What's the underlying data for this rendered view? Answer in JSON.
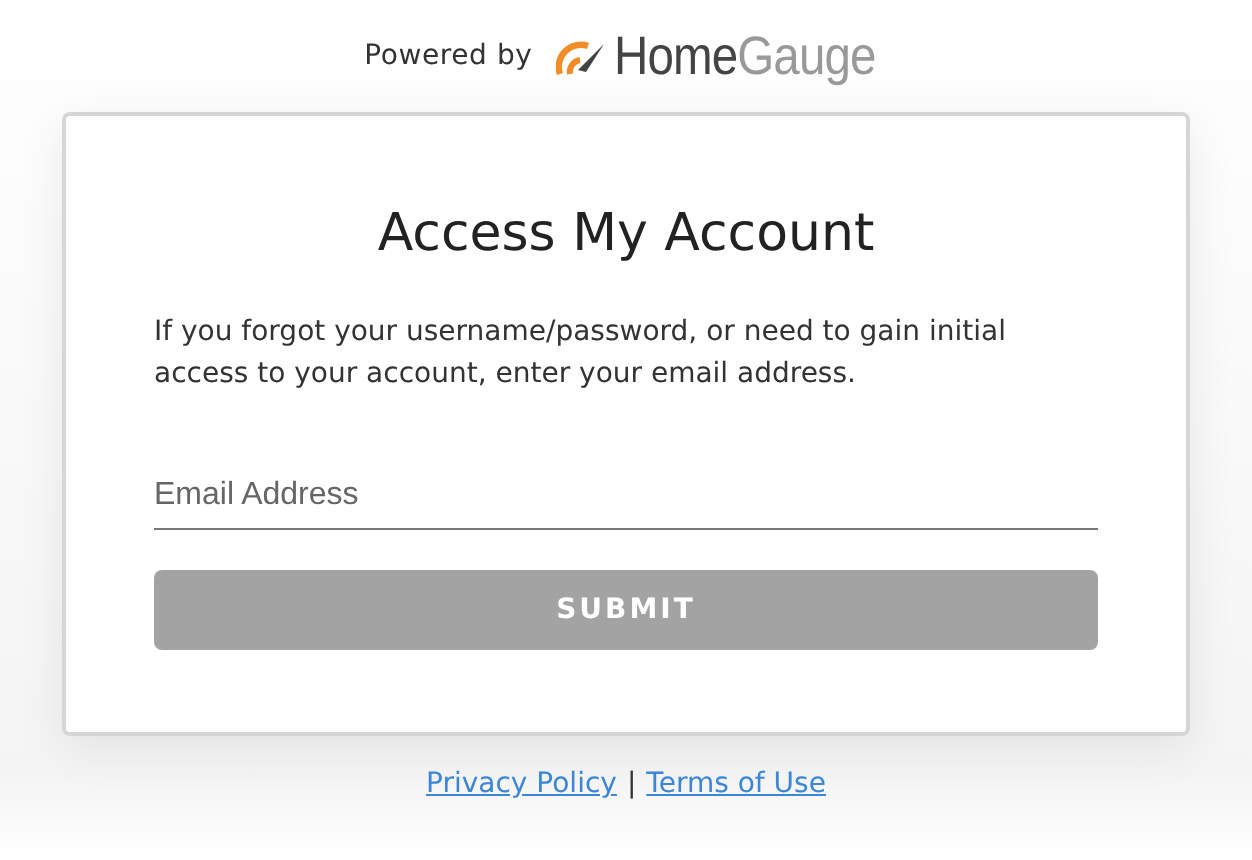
{
  "header": {
    "powered_by": "Powered by",
    "logo": [
      "Home",
      "Gauge"
    ]
  },
  "card": {
    "title": "Access My Account",
    "description": "If you forgot your username/password, or need to gain initial access to your account, enter your email address.",
    "email_field": {
      "placeholder": "Email Address"
    },
    "submit_button": {
      "label": "SUBMIT",
      "disabled": true
    }
  },
  "footer": {
    "links": [
      "Privacy Policy",
      "Terms of Use"
    ],
    "separator": "|"
  }
}
